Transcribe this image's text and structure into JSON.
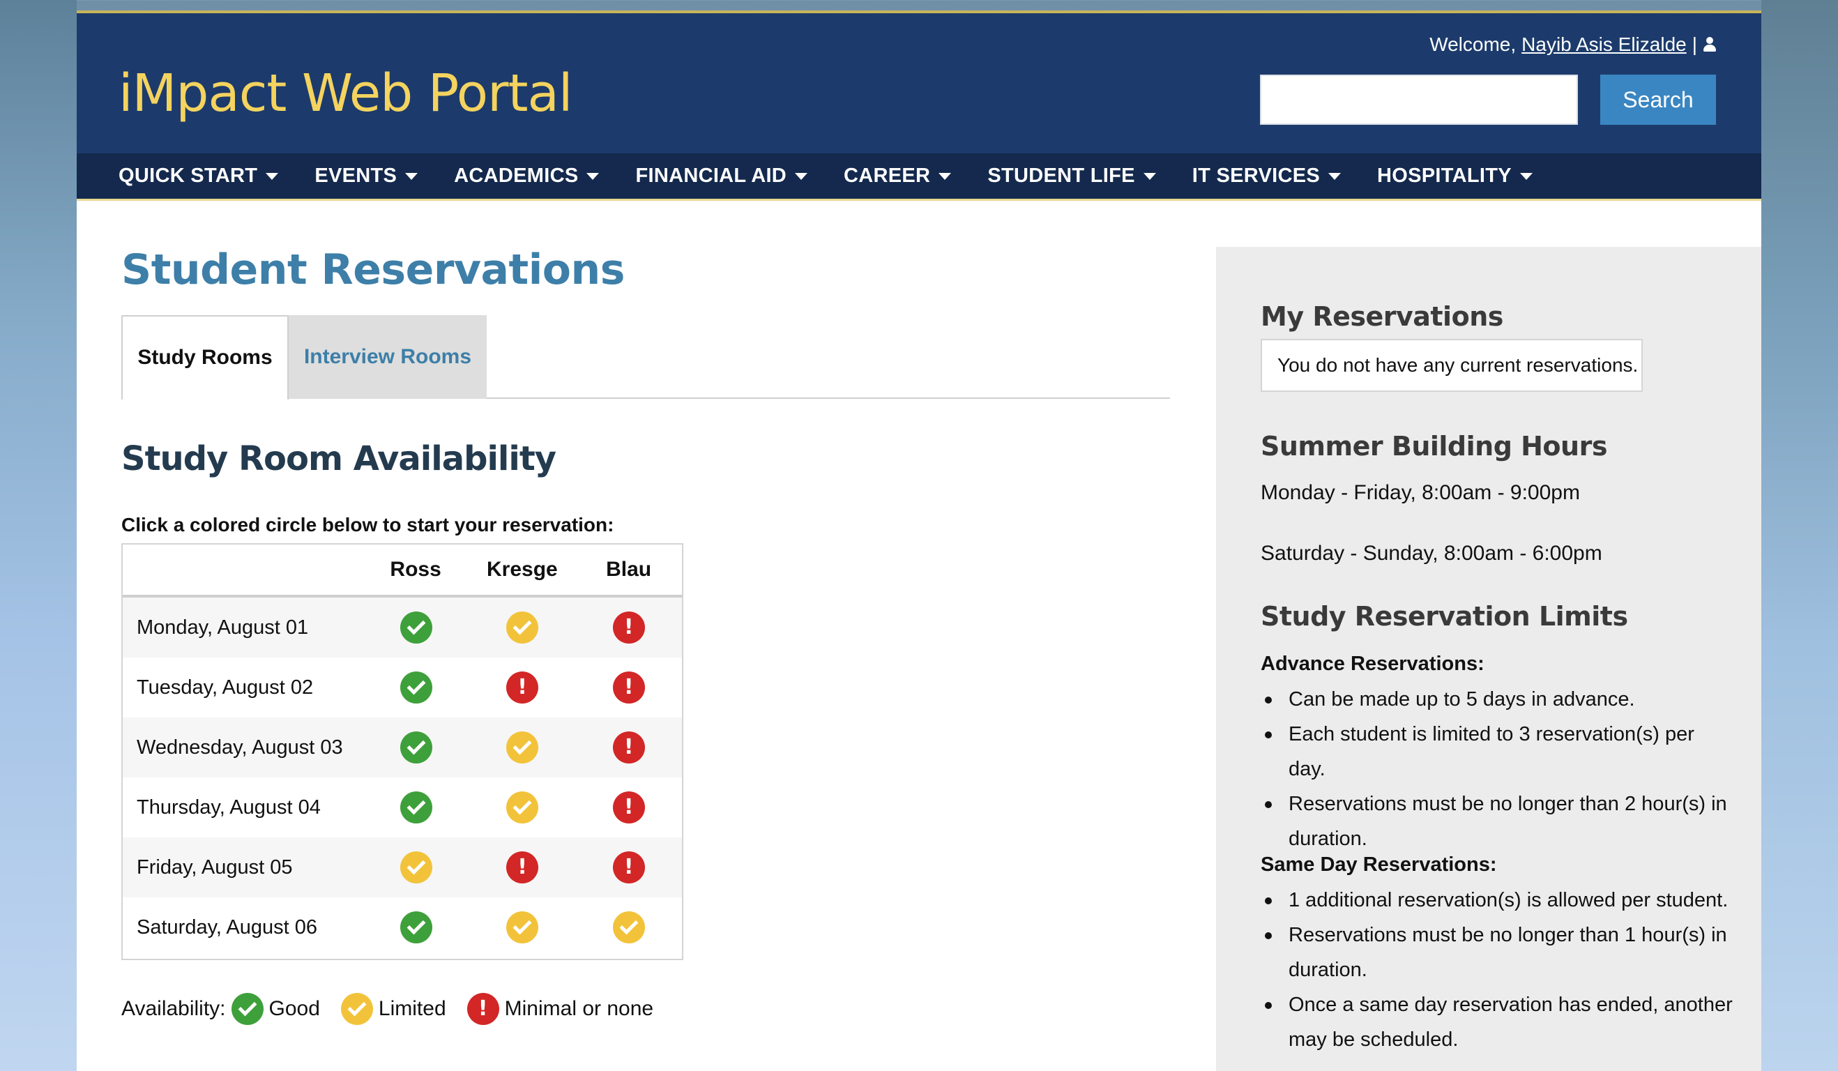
{
  "header": {
    "logo": "iMpact Web Portal",
    "welcome_prefix": "Welcome,",
    "user_name": "Nayib Asis Elizalde",
    "welcome_sep": "|",
    "search_placeholder": "",
    "search_button": "Search"
  },
  "nav": {
    "items": [
      {
        "label": "QUICK START"
      },
      {
        "label": "EVENTS"
      },
      {
        "label": "ACADEMICS"
      },
      {
        "label": "FINANCIAL AID"
      },
      {
        "label": "CAREER"
      },
      {
        "label": "STUDENT LIFE"
      },
      {
        "label": "IT SERVICES"
      },
      {
        "label": "HOSPITALITY"
      }
    ]
  },
  "main": {
    "title": "Student Reservations",
    "tabs": [
      {
        "label": "Study Rooms",
        "active": true
      },
      {
        "label": "Interview Rooms",
        "active": false
      }
    ],
    "section_title": "Study Room Availability",
    "instruction": "Click a colored circle below to start your reservation:",
    "table": {
      "columns": [
        "",
        "Ross",
        "Kresge",
        "Blau"
      ],
      "rows": [
        {
          "date": "Monday, August 01",
          "status": [
            "good",
            "limited",
            "none"
          ]
        },
        {
          "date": "Tuesday, August 02",
          "status": [
            "good",
            "none",
            "none"
          ]
        },
        {
          "date": "Wednesday, August 03",
          "status": [
            "good",
            "limited",
            "none"
          ]
        },
        {
          "date": "Thursday, August 04",
          "status": [
            "good",
            "limited",
            "none"
          ]
        },
        {
          "date": "Friday, August 05",
          "status": [
            "limited",
            "none",
            "none"
          ]
        },
        {
          "date": "Saturday, August 06",
          "status": [
            "good",
            "limited",
            "limited"
          ]
        }
      ]
    },
    "legend": {
      "label": "Availability:",
      "good": "Good",
      "limited": "Limited",
      "none": "Minimal or none"
    }
  },
  "colors": {
    "good": "#3ea03a",
    "limited": "#f2c33a",
    "none": "#d32626",
    "header_bg": "#1c3b6c",
    "logo": "#f4d35e",
    "title": "#3d7fa8"
  },
  "sidebar": {
    "my_reservations_title": "My Reservations",
    "no_reservations": "You do not have any current reservations.",
    "hours_title": "Summer Building Hours",
    "hours_weekday": "Monday - Friday, 8:00am - 9:00pm",
    "hours_weekend": "Saturday - Sunday, 8:00am - 6:00pm",
    "limits_title": "Study Reservation Limits",
    "advance_title": "Advance Reservations:",
    "advance_items": [
      "Can be made up to 5 days in advance.",
      "Each student is limited to 3 reservation(s) per day.",
      "Reservations must be no longer than 2 hour(s) in duration."
    ],
    "same_day_title": "Same Day Reservations:",
    "same_day_items": [
      "1 additional reservation(s) is allowed per student.",
      "Reservations must be no longer than 1 hour(s) in duration.",
      "Once a same day reservation has ended, another may be scheduled."
    ]
  }
}
